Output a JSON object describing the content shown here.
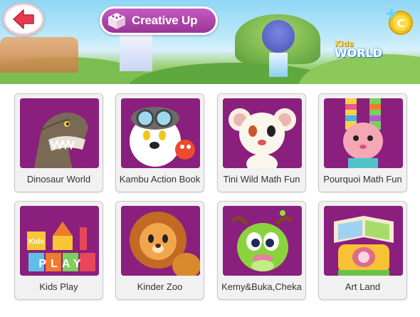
{
  "header": {
    "title": "Creative Up",
    "logo": {
      "kids": "Kids",
      "world": "WORLD"
    },
    "colors": {
      "title_bg": "#a8389f",
      "back_arrow": "#e8394f",
      "coin": "#f2c417"
    }
  },
  "icons": {
    "back": "back-arrow-icon",
    "title_cube": "cube-icon",
    "coin": "coin-plus-icon"
  },
  "apps": [
    {
      "label": "Dinosaur World",
      "thumbnail": "dinosaur-thumbnail"
    },
    {
      "label": "Kambu Action Book",
      "thumbnail": "kambu-dog-thumbnail"
    },
    {
      "label": "Tini Wild Math Fun",
      "thumbnail": "tini-bear-thumbnail"
    },
    {
      "label": "Pourquoi Math Fun",
      "thumbnail": "pourquoi-rabbit-thumbnail"
    },
    {
      "label": "Kids Play",
      "thumbnail": "kids-play-blocks-thumbnail",
      "thumb_text": [
        "Kids",
        "PLAY"
      ]
    },
    {
      "label": "Kinder Zoo",
      "thumbnail": "lion-thumbnail"
    },
    {
      "label": "Kemy&Buka,Cheka",
      "thumbnail": "green-monster-thumbnail"
    },
    {
      "label": "Art Land",
      "thumbnail": "art-land-book-thumbnail"
    }
  ]
}
